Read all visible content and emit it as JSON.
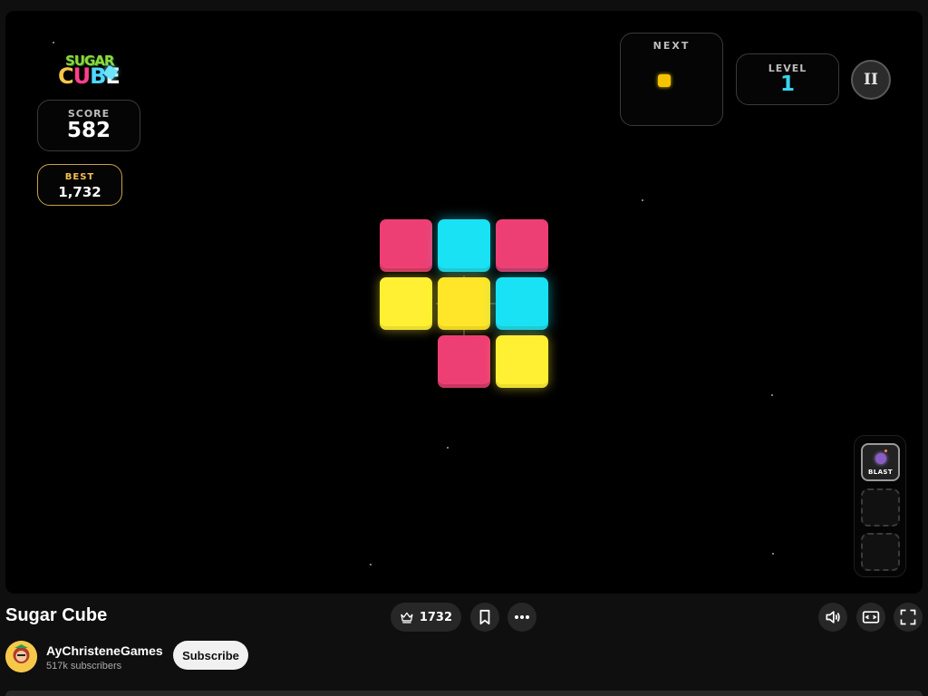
{
  "game": {
    "logo_text_line1": "SUGAR",
    "logo_text_line2": "CUBE",
    "score_label": "SCORE",
    "score_value": "582",
    "best_label": "BEST",
    "best_value": "1,732",
    "next_label": "NEXT",
    "next_piece_color": "#f5c400",
    "level_label": "LEVEL",
    "level_value": "1",
    "pause_label": "II",
    "board": {
      "rows": 3,
      "cols": 3,
      "cells": [
        [
          "pink",
          "cyan",
          "pink"
        ],
        [
          "yellow",
          "yellow",
          "cyan"
        ],
        [
          "empty",
          "pink",
          "yellow"
        ]
      ]
    },
    "powerups": [
      {
        "label": "BLAST",
        "icon": "bomb-icon",
        "filled": true
      },
      {
        "label": "",
        "icon": "",
        "filled": false
      },
      {
        "label": "",
        "icon": "",
        "filled": false
      }
    ],
    "colors": {
      "pink": "#ee3f74",
      "cyan": "#19e2f5",
      "yellow": "#fff033",
      "level_accent": "#38d3f0",
      "best_accent": "#f2c14e"
    }
  },
  "bottom_bar": {
    "title": "Sugar Cube",
    "high_score_pill": "1732",
    "channel_name": "AyChristeneGames",
    "subscribers": "517k subscribers",
    "subscribe_label": "Subscribe"
  }
}
